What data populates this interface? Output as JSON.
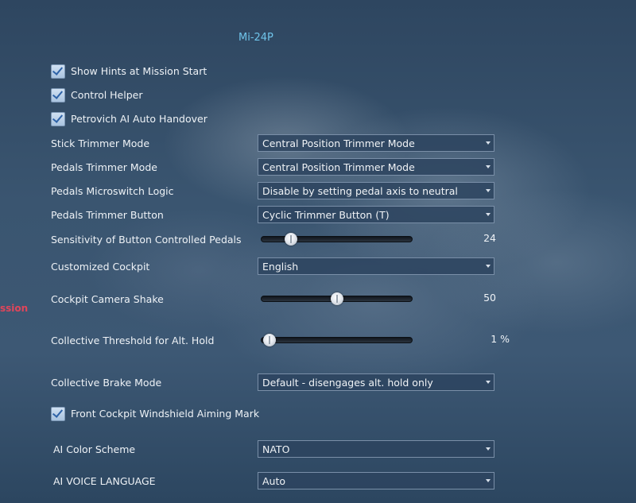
{
  "page_title": "Mi-24P",
  "side_text": "ssion",
  "checkboxes": {
    "show_hints": {
      "label": "Show Hints at Mission Start",
      "checked": true
    },
    "control_helper": {
      "label": "Control Helper",
      "checked": true
    },
    "petrovich": {
      "label": "Petrovich AI Auto Handover",
      "checked": true
    },
    "windshield": {
      "label": "Front Cockpit Windshield Aiming Mark",
      "checked": true
    }
  },
  "selects": {
    "stick_trimmer": {
      "label": "Stick Trimmer Mode",
      "value": "Central Position Trimmer Mode"
    },
    "pedals_trimmer": {
      "label": "Pedals Trimmer Mode",
      "value": "Central Position Trimmer Mode"
    },
    "microswitch": {
      "label": "Pedals Microswitch Logic",
      "value": "Disable by setting pedal axis to neutral"
    },
    "trimmer_button": {
      "label": "Pedals Trimmer Button",
      "value": "Cyclic Trimmer Button (T)"
    },
    "cockpit": {
      "label": "Customized Cockpit",
      "value": "English"
    },
    "brake": {
      "label": "Collective Brake Mode",
      "value": "Default - disengages alt. hold only"
    },
    "ai_color": {
      "label": "AI Color Scheme",
      "value": "NATO"
    },
    "ai_voice": {
      "label": "AI VOICE LANGUAGE",
      "value": "Auto"
    }
  },
  "sliders": {
    "pedal_sensitivity": {
      "label": "Sensitivity of Button Controlled Pedals",
      "display": "24",
      "fraction": 0.18
    },
    "camera_shake": {
      "label": "Cockpit Camera Shake",
      "display": "50",
      "fraction": 0.5
    },
    "collective_threshold": {
      "label": "Collective Threshold for Alt. Hold",
      "display": "1 %",
      "fraction": 0.03
    }
  },
  "icons": {
    "check": "checkmark-icon",
    "dropdown": "chevron-down-icon",
    "slider_thumb": "slider-thumb-icon"
  }
}
